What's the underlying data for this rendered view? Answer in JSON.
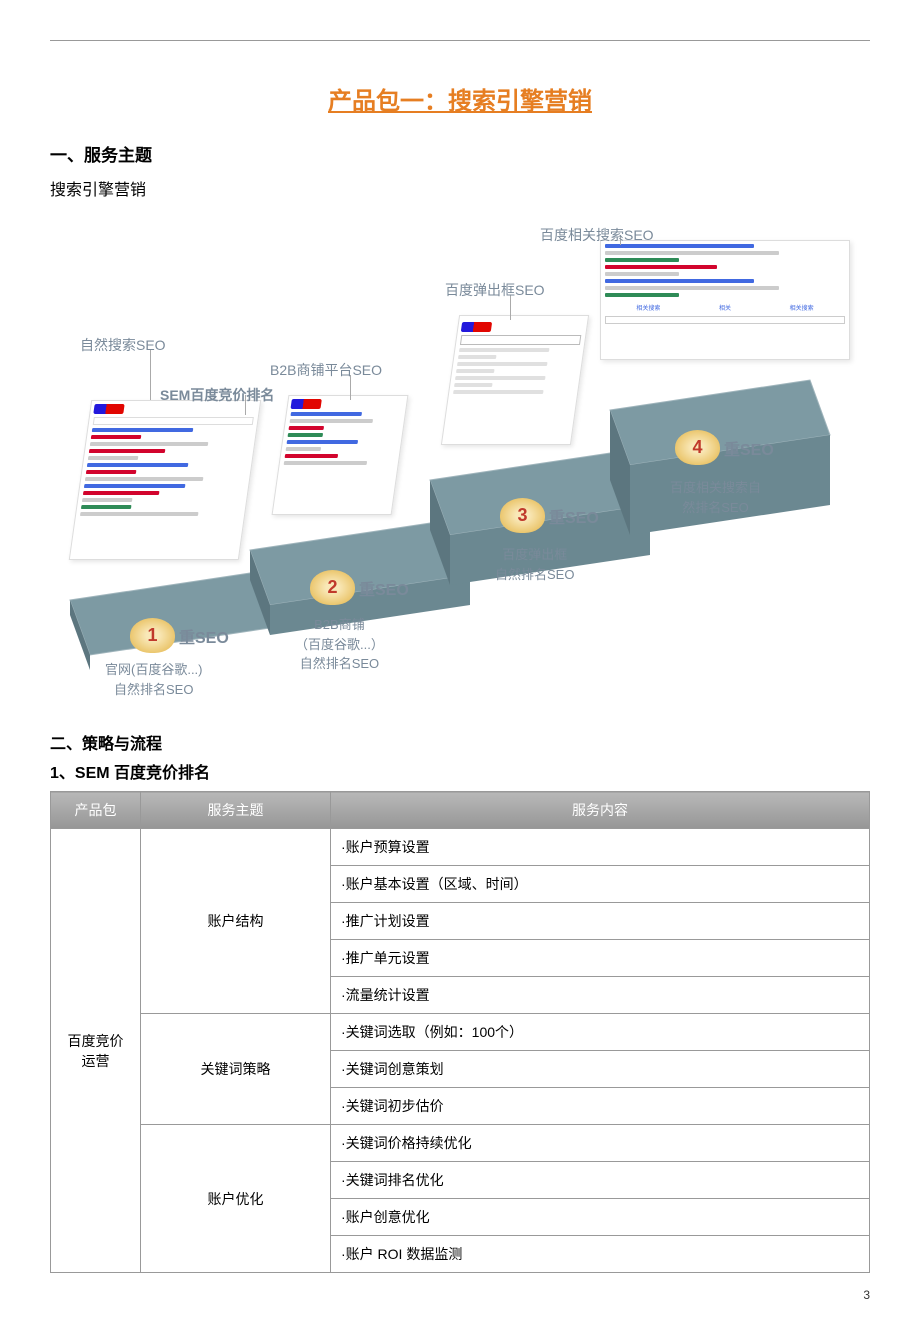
{
  "title": "产品包一：搜索引擎营销",
  "section1": {
    "heading": "一、服务主题",
    "text": "搜索引擎营销"
  },
  "diagram": {
    "labels": {
      "natural_search": "自然搜索SEO",
      "sem_bidding": "SEM百度竞价排名",
      "b2b_platform": "B2B商铺平台SEO",
      "baidu_popup": "百度弹出框SEO",
      "baidu_related": "百度相关搜索SEO"
    },
    "steps": [
      {
        "num": "1",
        "label": "重SEO",
        "caption": "官网(百度谷歌...)\n自然排名SEO"
      },
      {
        "num": "2",
        "label": "重SEO",
        "caption": "B2B商铺\n（百度谷歌...）\n自然排名SEO"
      },
      {
        "num": "3",
        "label": "重SEO",
        "caption": "百度弹出框\n自然排名SEO"
      },
      {
        "num": "4",
        "label": "重SEO",
        "caption": "百度相关搜索自\n然排名SEO"
      }
    ]
  },
  "section2": {
    "heading": "二、策略与流程",
    "sub1": "1、SEM 百度竞价排名"
  },
  "table": {
    "headers": [
      "产品包",
      "服务主题",
      "服务内容"
    ],
    "product": "百度竞价\n运营",
    "groups": [
      {
        "theme": "账户结构",
        "items": [
          "·账户预算设置",
          "·账户基本设置（区域、时间）",
          "·推广计划设置",
          "·推广单元设置",
          "·流量统计设置"
        ]
      },
      {
        "theme": "关键词策略",
        "items": [
          "·关键词选取（例如：100个）",
          "·关键词创意策划",
          "·关键词初步估价"
        ]
      },
      {
        "theme": "账户优化",
        "items": [
          "·关键词价格持续优化",
          "·关键词排名优化",
          "·账户创意优化",
          "·账户 ROI 数据监测"
        ]
      }
    ]
  },
  "pageNumber": "3"
}
